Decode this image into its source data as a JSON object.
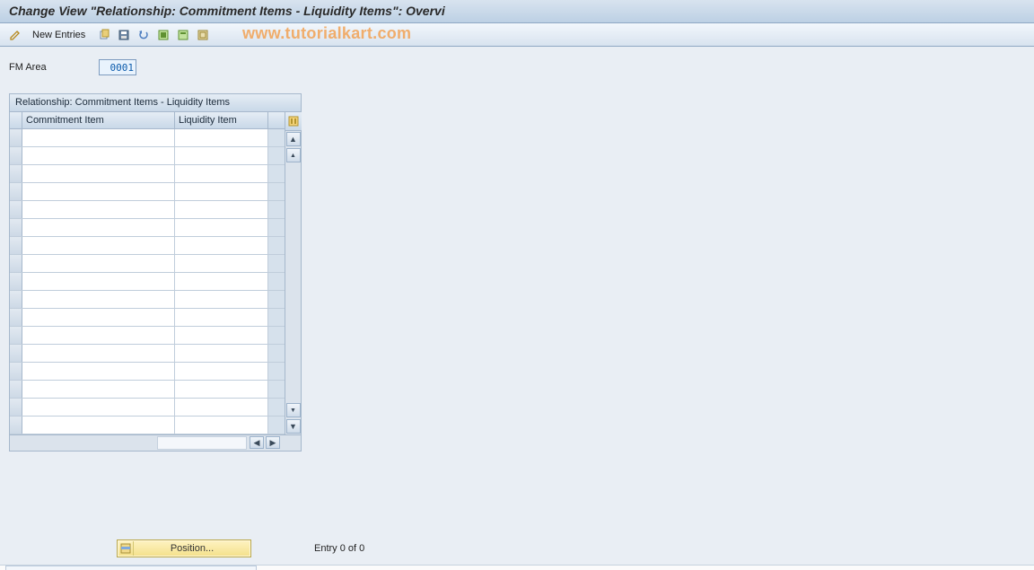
{
  "header": {
    "title": "Change View \"Relationship: Commitment Items - Liquidity Items\": Overvi"
  },
  "toolbar": {
    "new_entries_label": "New Entries"
  },
  "watermark": "www.tutorialkart.com",
  "form": {
    "fm_area_label": "FM Area",
    "fm_area_value": "0001"
  },
  "table": {
    "title": "Relationship: Commitment Items - Liquidity Items",
    "columns": {
      "commitment": "Commitment Item",
      "liquidity": "Liquidity Item"
    },
    "rows": [
      {
        "commitment": "",
        "liquidity": ""
      },
      {
        "commitment": "",
        "liquidity": ""
      },
      {
        "commitment": "",
        "liquidity": ""
      },
      {
        "commitment": "",
        "liquidity": ""
      },
      {
        "commitment": "",
        "liquidity": ""
      },
      {
        "commitment": "",
        "liquidity": ""
      },
      {
        "commitment": "",
        "liquidity": ""
      },
      {
        "commitment": "",
        "liquidity": ""
      },
      {
        "commitment": "",
        "liquidity": ""
      },
      {
        "commitment": "",
        "liquidity": ""
      },
      {
        "commitment": "",
        "liquidity": ""
      },
      {
        "commitment": "",
        "liquidity": ""
      },
      {
        "commitment": "",
        "liquidity": ""
      },
      {
        "commitment": "",
        "liquidity": ""
      },
      {
        "commitment": "",
        "liquidity": ""
      },
      {
        "commitment": "",
        "liquidity": ""
      },
      {
        "commitment": "",
        "liquidity": ""
      }
    ]
  },
  "footer": {
    "position_label": "Position...",
    "entry_text": "Entry 0 of 0"
  }
}
